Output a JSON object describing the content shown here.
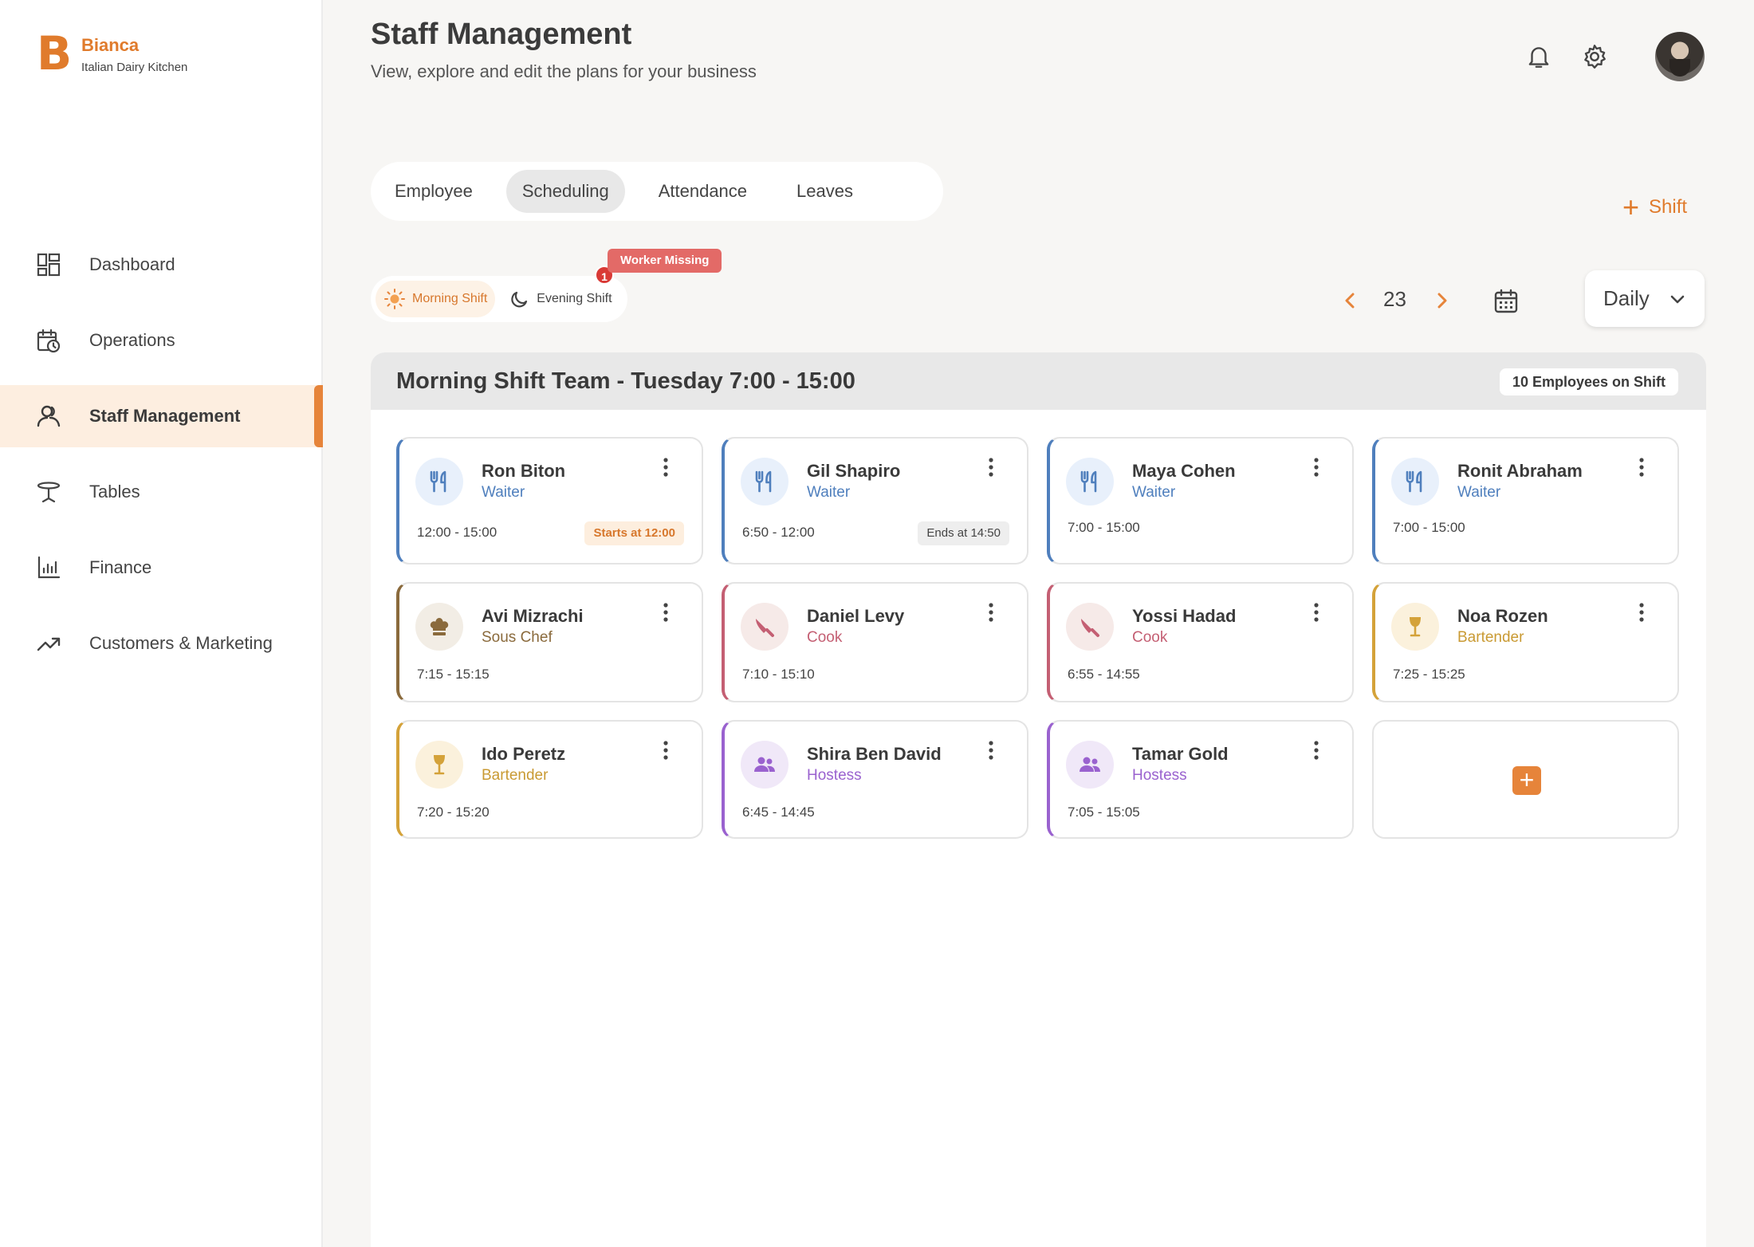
{
  "brand": {
    "logo": "B",
    "name": "Bianca",
    "subtitle": "Italian Dairy Kitchen",
    "accent": "#e07b2c"
  },
  "sidebar": {
    "items": [
      {
        "label": "Dashboard",
        "icon": "dashboard-icon"
      },
      {
        "label": "Operations",
        "icon": "calendar-clock-icon"
      },
      {
        "label": "Staff Management",
        "icon": "staff-icon",
        "active": true
      },
      {
        "label": "Tables",
        "icon": "table-icon"
      },
      {
        "label": "Finance",
        "icon": "bar-chart-icon"
      },
      {
        "label": "Customers & Marketing",
        "icon": "trend-up-icon"
      }
    ]
  },
  "header": {
    "title": "Staff Management",
    "subtitle": "View, explore and edit the plans for your business",
    "icons": [
      "bell-icon",
      "gear-icon",
      "avatar"
    ]
  },
  "tabs": [
    {
      "label": "Employee"
    },
    {
      "label": "Scheduling",
      "active": true
    },
    {
      "label": "Attendance"
    },
    {
      "label": "Leaves"
    }
  ],
  "actions": {
    "add_shift": "Shift"
  },
  "shift_toggle": {
    "morning": "Morning Shift",
    "evening": "Evening Shift",
    "alert_count": "1",
    "alert_label": "Worker Missing"
  },
  "date_nav": {
    "day": "23",
    "view": "Daily"
  },
  "panel": {
    "title": "Morning Shift Team - Tuesday 7:00 - 15:00",
    "badge": "10 Employees on Shift"
  },
  "employees": [
    {
      "name": "Ron Biton",
      "role": "Waiter",
      "time": "12:00 - 15:00",
      "tag": "Starts at 12:00"
    },
    {
      "name": "Gil Shapiro",
      "role": "Waiter",
      "time": "6:50 - 12:00",
      "tag": "Ends at 14:50"
    },
    {
      "name": "Maya Cohen",
      "role": "Waiter",
      "time": "7:00 - 15:00"
    },
    {
      "name": "Ronit Abraham",
      "role": "Waiter",
      "time": "7:00 - 15:00"
    },
    {
      "name": "Avi Mizrachi",
      "role": "Sous Chef",
      "time": "7:15 - 15:15"
    },
    {
      "name": "Daniel Levy",
      "role": "Cook",
      "time": "7:10 - 15:10"
    },
    {
      "name": "Yossi Hadad",
      "role": "Cook",
      "time": "6:55 - 14:55"
    },
    {
      "name": "Noa Rozen",
      "role": "Bartender",
      "time": "7:25 - 15:25"
    },
    {
      "name": "Ido Peretz",
      "role": "Bartender",
      "time": "7:20 - 15:20"
    },
    {
      "name": "Shira Ben David",
      "role": "Hostess",
      "time": "6:45 - 14:45"
    },
    {
      "name": "Tamar Gold",
      "role": "Hostess",
      "time": "7:05 - 15:05"
    }
  ],
  "colors": {
    "waiter": "#4f7fbd",
    "chef": "#8a6a3c",
    "cook": "#c45f73",
    "bartender": "#d4a239",
    "hostess": "#9a62cf",
    "alert": "#e36a67"
  }
}
